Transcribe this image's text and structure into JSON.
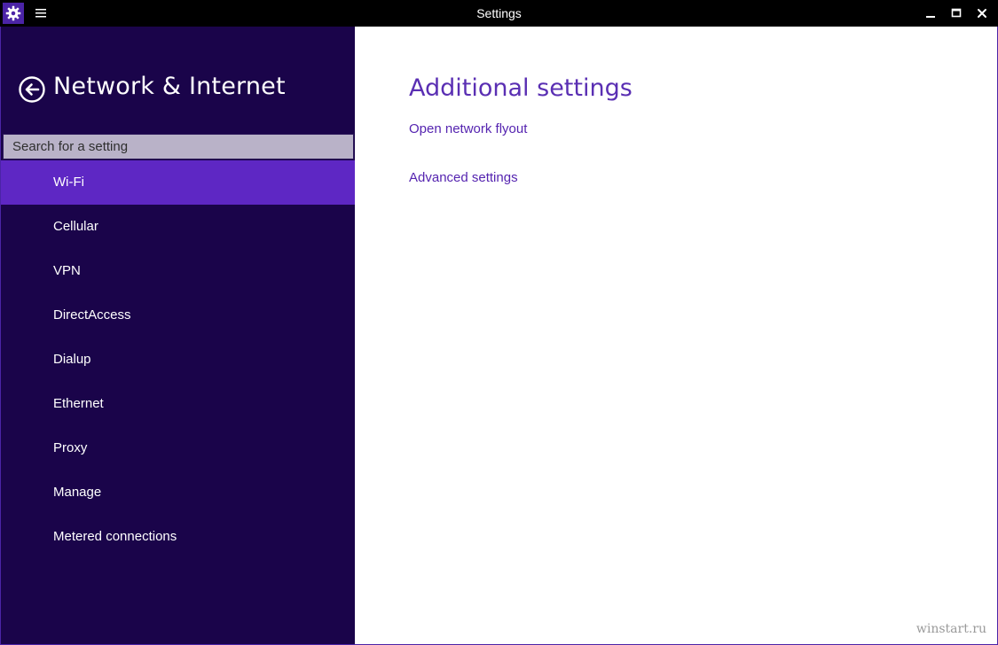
{
  "titlebar": {
    "title": "Settings",
    "app_icon": "gear-icon",
    "menu_icon": "hamburger-icon",
    "controls": [
      "minimize-icon",
      "maximize-icon",
      "close-icon"
    ]
  },
  "sidebar": {
    "back_icon": "back-arrow-icon",
    "title": "Network & Internet",
    "search": {
      "placeholder": "Search for a setting",
      "value": ""
    },
    "items": [
      {
        "label": "Wi-Fi",
        "selected": true
      },
      {
        "label": "Cellular",
        "selected": false
      },
      {
        "label": "VPN",
        "selected": false
      },
      {
        "label": "DirectAccess",
        "selected": false
      },
      {
        "label": "Dialup",
        "selected": false
      },
      {
        "label": "Ethernet",
        "selected": false
      },
      {
        "label": "Proxy",
        "selected": false
      },
      {
        "label": "Manage",
        "selected": false
      },
      {
        "label": "Metered connections",
        "selected": false
      }
    ]
  },
  "main": {
    "heading": "Additional settings",
    "links": [
      "Open network flyout",
      "Advanced settings"
    ]
  },
  "watermark": "winstart.ru",
  "colors": {
    "titlebar_bg": "#000000",
    "sidebar_bg": "#1a044a",
    "selected_item_bg": "#5e27c4",
    "accent_text": "#5a2fb3",
    "search_bg": "#b9b2c8"
  }
}
